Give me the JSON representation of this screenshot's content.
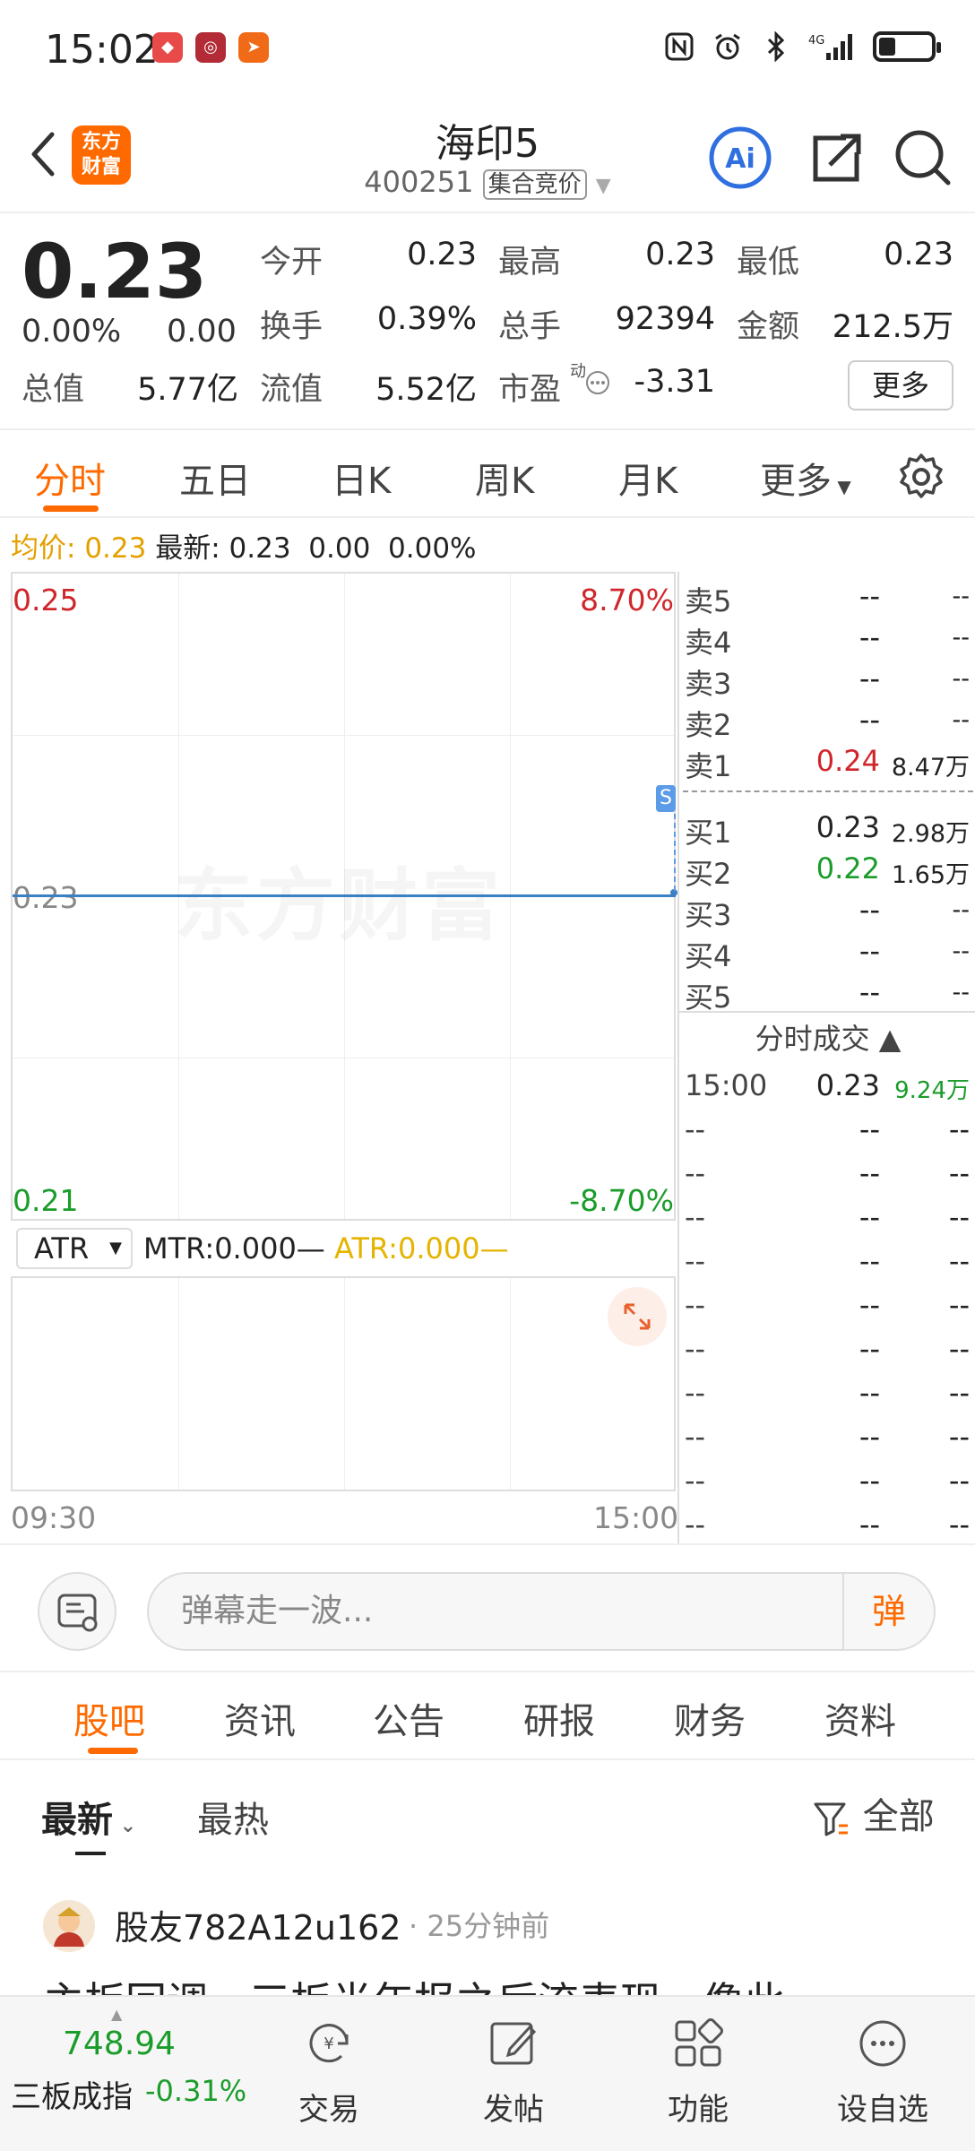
{
  "status_bar": {
    "time": "15:02",
    "network": "4G"
  },
  "header": {
    "app_logo_text": "东方\n财富",
    "stock_name": "海印5",
    "stock_code": "400251",
    "market_tag": "集合竞价",
    "ai_label": "Ai"
  },
  "quote": {
    "price": "0.23",
    "change_pct": "0.00%",
    "change": "0.00",
    "market_cap_label": "总值",
    "market_cap": "5.77亿",
    "stats": [
      {
        "label": "今开",
        "value": "0.23"
      },
      {
        "label": "最高",
        "value": "0.23"
      },
      {
        "label": "最低",
        "value": "0.23"
      },
      {
        "label": "换手",
        "value": "0.39%"
      },
      {
        "label": "总手",
        "value": "92394"
      },
      {
        "label": "金额",
        "value": "212.5万"
      },
      {
        "label": "流值",
        "value": "5.52亿"
      },
      {
        "label": "市盈",
        "value": "-3.31"
      }
    ],
    "pe_superscript": "动",
    "more_label": "更多"
  },
  "tabs": [
    "分时",
    "五日",
    "日K",
    "周K",
    "月K",
    "更多"
  ],
  "avg_line": {
    "avg_label": "均价:",
    "avg_value": "0.23",
    "latest_label": "最新:",
    "latest_value": "0.23",
    "change": "0.00",
    "change_pct": "0.00%"
  },
  "chart": {
    "y_top": "0.25",
    "y_mid": "0.23",
    "y_bottom": "0.21",
    "pct_top": "8.70%",
    "pct_bottom": "-8.70%",
    "watermark": "东方财富",
    "marker": "S",
    "x_start": "09:30",
    "x_end": "15:00",
    "price_line_value": 0.23
  },
  "indicator": {
    "selected": "ATR",
    "mtr_text": "MTR:0.000—",
    "atr_text": "ATR:0.000—"
  },
  "order_book": {
    "asks": [
      {
        "label": "卖5",
        "price": "--",
        "vol": "--"
      },
      {
        "label": "卖4",
        "price": "--",
        "vol": "--"
      },
      {
        "label": "卖3",
        "price": "--",
        "vol": "--"
      },
      {
        "label": "卖2",
        "price": "--",
        "vol": "--"
      },
      {
        "label": "卖1",
        "price": "0.24",
        "vol": "8.47万"
      }
    ],
    "bids": [
      {
        "label": "买1",
        "price": "0.23",
        "vol": "2.98万"
      },
      {
        "label": "买2",
        "price": "0.22",
        "vol": "1.65万"
      },
      {
        "label": "买3",
        "price": "--",
        "vol": "--"
      },
      {
        "label": "买4",
        "price": "--",
        "vol": "--"
      },
      {
        "label": "买5",
        "price": "--",
        "vol": "--"
      }
    ],
    "trades_title": "分时成交 ▲",
    "trades": [
      {
        "time": "15:00",
        "price": "0.23",
        "vol": "9.24万"
      },
      {
        "time": "--",
        "price": "--",
        "vol": "--"
      },
      {
        "time": "--",
        "price": "--",
        "vol": "--"
      },
      {
        "time": "--",
        "price": "--",
        "vol": "--"
      },
      {
        "time": "--",
        "price": "--",
        "vol": "--"
      },
      {
        "time": "--",
        "price": "--",
        "vol": "--"
      },
      {
        "time": "--",
        "price": "--",
        "vol": "--"
      },
      {
        "time": "--",
        "price": "--",
        "vol": "--"
      },
      {
        "time": "--",
        "price": "--",
        "vol": "--"
      },
      {
        "time": "--",
        "price": "--",
        "vol": "--"
      },
      {
        "time": "--",
        "price": "--",
        "vol": "--"
      }
    ]
  },
  "danmu": {
    "placeholder": "弹幕走一波...",
    "send_label": "弹"
  },
  "sub_tabs": [
    "股吧",
    "资讯",
    "公告",
    "研报",
    "财务",
    "资料"
  ],
  "sort": {
    "latest": "最新",
    "hot": "最热",
    "filter": "全部"
  },
  "post": {
    "user": "股友782A12u162",
    "time": "· 25分钟前",
    "title": "主板回调，三板半年报之后流表现，像此"
  },
  "bottom_bar": {
    "index_value": "748.94",
    "index_name": "三板成指",
    "index_change": "-0.31%",
    "items": [
      "交易",
      "发帖",
      "功能",
      "设自选"
    ]
  },
  "colors": {
    "accent": "#ff6a00",
    "up": "#d0262b",
    "down": "#1a9c2a",
    "line": "#3b7fc4"
  }
}
